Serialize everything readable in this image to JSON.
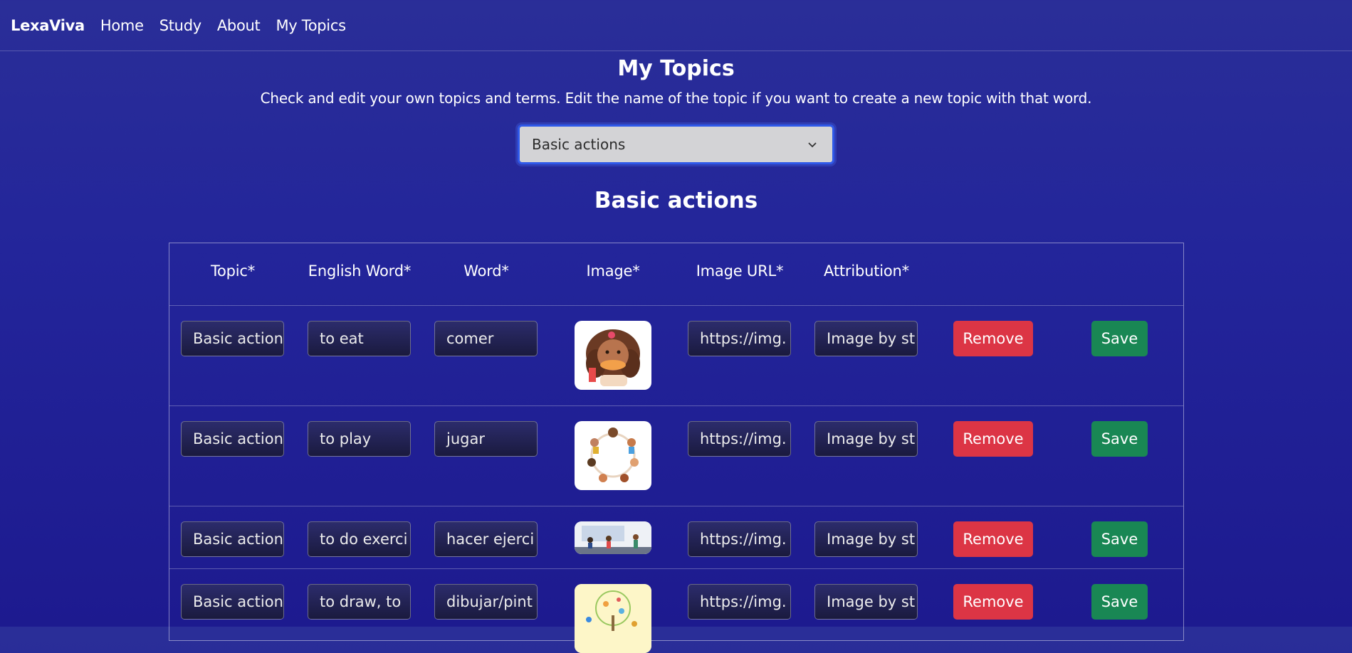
{
  "nav": {
    "brand": "LexaViva",
    "links": [
      "Home",
      "Study",
      "About",
      "My Topics"
    ]
  },
  "page": {
    "title": "My Topics",
    "description": "Check and edit your own topics and terms. Edit the name of the topic if you want to create a new topic with that word."
  },
  "topic_select": {
    "selected": "Basic actions"
  },
  "section_title": "Basic actions",
  "table": {
    "headers": [
      "Topic*",
      "English Word*",
      "Word*",
      "Image*",
      "Image URL*",
      "Attribution*"
    ],
    "rows": [
      {
        "topic": "Basic action",
        "english": "to eat",
        "word": "comer",
        "image_url": "https://img.",
        "attribution": "Image by st",
        "image_icon": "girl-eating-illustration"
      },
      {
        "topic": "Basic action",
        "english": "to play",
        "word": "jugar",
        "image_url": "https://img.",
        "attribution": "Image by st",
        "image_icon": "kids-playing-circle-illustration"
      },
      {
        "topic": "Basic action",
        "english": "to do exerci",
        "word": "hacer ejerci",
        "image_url": "https://img.",
        "attribution": "Image by st",
        "image_icon": "gym-exercise-illustration"
      },
      {
        "topic": "Basic action",
        "english": "to draw, to",
        "word": "dibujar/pint",
        "image_url": "https://img.",
        "attribution": "Image by st",
        "image_icon": "kids-painting-tree-illustration"
      }
    ],
    "remove_label": "Remove",
    "save_label": "Save"
  },
  "colors": {
    "background": "#23259a",
    "remove": "#dc3545",
    "save": "#198754",
    "select_border": "#2f58e8"
  }
}
